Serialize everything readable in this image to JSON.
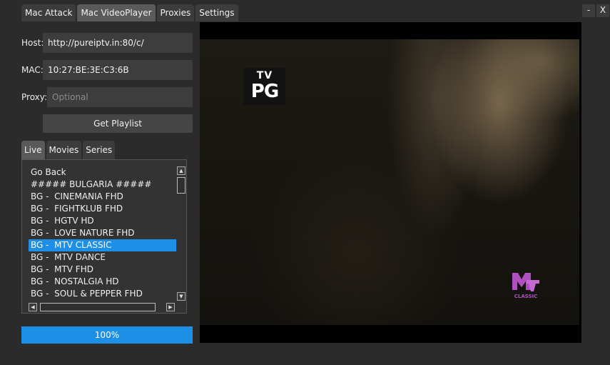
{
  "main_tabs": [
    {
      "label": "Mac Attack",
      "active": false
    },
    {
      "label": "Mac VideoPlayer",
      "active": true
    },
    {
      "label": "Proxies",
      "active": false
    },
    {
      "label": "Settings",
      "active": false
    }
  ],
  "window_controls": {
    "minimize": "-",
    "close": "X"
  },
  "form": {
    "host_label": "Host:",
    "host_value": "http://pureiptv.in:80/c/",
    "mac_label": "MAC:",
    "mac_value": "10:27:BE:3E:C3:6B",
    "proxy_label": "Proxy:",
    "proxy_value": "",
    "proxy_placeholder": "Optional",
    "get_playlist_label": "Get Playlist"
  },
  "sub_tabs": [
    {
      "label": "Live",
      "active": true
    },
    {
      "label": "Movies",
      "active": false
    },
    {
      "label": "Series",
      "active": false
    }
  ],
  "playlist": {
    "items": [
      "Go Back",
      "##### BULGARIA #####",
      "BG -  CINEMANIA FHD",
      "BG -  FIGHTKLUB FHD",
      "BG -  HGTV HD",
      "BG -  LOVE NATURE FHD",
      "BG -  MTV CLASSIC",
      "BG -  MTV DANCE",
      "BG -  MTV FHD",
      "BG -  NOSTALGIA HD",
      "BG -  SOUL & PEPPER FHD"
    ],
    "selected_index": 6
  },
  "progress": {
    "text": "100%",
    "value": 100
  },
  "video": {
    "rating_top": "TV",
    "rating_bottom": "PG",
    "channel_logo": "MTV CLASSIC",
    "colors": {
      "accent": "#1e8fe6",
      "mtv_logo": "#b04fc0"
    }
  }
}
